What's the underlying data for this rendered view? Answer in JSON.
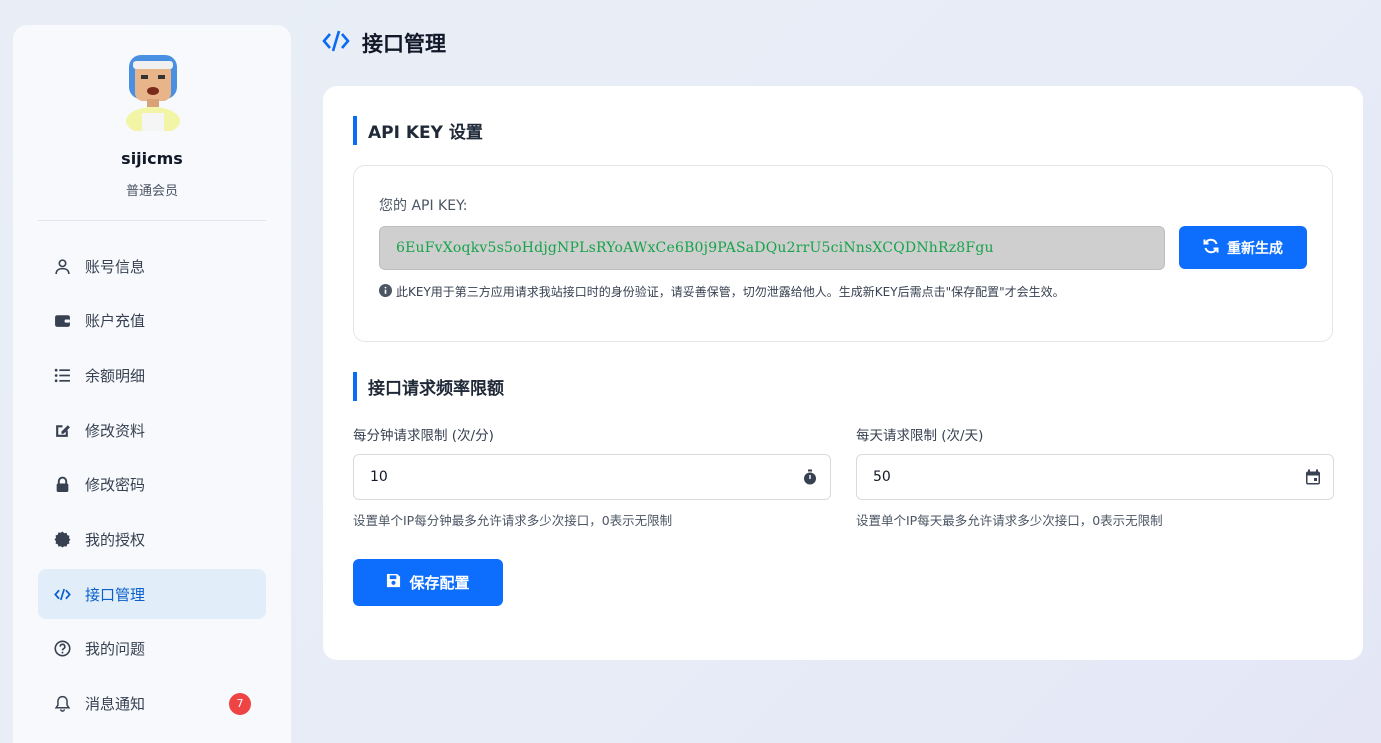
{
  "header": {
    "title": "接口管理",
    "icon": "code-icon"
  },
  "user": {
    "name": "sijicms",
    "level": "普通会员",
    "avatar": "avatar-image"
  },
  "sidebar": {
    "items": [
      {
        "label": "账号信息",
        "icon": "user-icon"
      },
      {
        "label": "账户充值",
        "icon": "wallet-icon"
      },
      {
        "label": "余额明细",
        "icon": "list-icon"
      },
      {
        "label": "修改资料",
        "icon": "edit-icon"
      },
      {
        "label": "修改密码",
        "icon": "lock-icon"
      },
      {
        "label": "我的授权",
        "icon": "certificate-icon"
      },
      {
        "label": "接口管理",
        "icon": "code-icon",
        "active": true
      },
      {
        "label": "我的问题",
        "icon": "question-icon"
      },
      {
        "label": "消息通知",
        "icon": "bell-icon",
        "badge": "7"
      }
    ]
  },
  "api_key": {
    "section_title": "API KEY 设置",
    "label": "您的 API KEY:",
    "value": "6EuFvXoqkv5s5oHdjgNPLsRYoAWxCe6B0j9PASaDQu2rrU5ciNnsXCQDNhRz8Fgu",
    "regenerate_label": "重新生成",
    "note": "此KEY用于第三方应用请求我站接口时的身份验证，请妥善保管，切勿泄露给他人。生成新KEY后需点击\"保存配置\"才会生效。"
  },
  "rate_limit": {
    "section_title": "接口请求频率限额",
    "per_minute": {
      "label": "每分钟请求限制 (次/分)",
      "value": "10",
      "help": "设置单个IP每分钟最多允许请求多少次接口，0表示无限制",
      "icon": "stopwatch-icon"
    },
    "per_day": {
      "label": "每天请求限制 (次/天)",
      "value": "50",
      "help": "设置单个IP每天最多允许请求多少次接口，0表示无限制",
      "icon": "calendar-icon"
    }
  },
  "save_label": "保存配置",
  "colors": {
    "primary": "#0d6efd",
    "active_bg": "#e1eef9",
    "badge": "#ef4444",
    "key_text": "#16a34a"
  }
}
